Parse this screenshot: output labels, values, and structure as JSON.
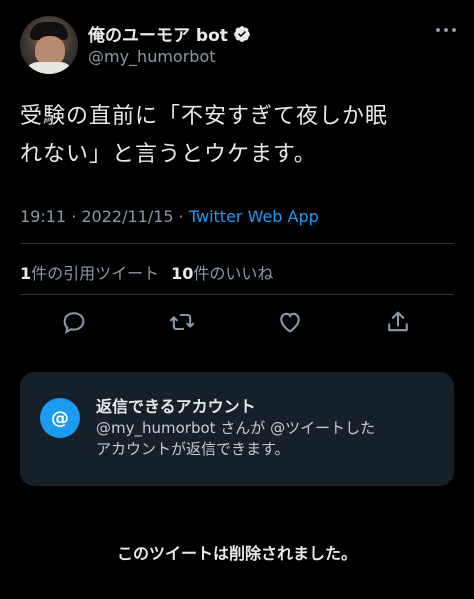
{
  "author": {
    "display_name": "俺のユーモア bot",
    "handle": "@my_humorbot",
    "verified": true,
    "avatar": "avatar-photo"
  },
  "tweet": {
    "text_line1": "受験の直前に「不安すぎて夜しか眠",
    "text_line2": "れない」と言うとウケます。",
    "time": "19:11",
    "sep1": " · ",
    "date": "2022/11/15",
    "sep2": " · ",
    "source": "Twitter Web App"
  },
  "stats": {
    "quotes_count": "1",
    "quotes_label": "件の引用ツイート",
    "likes_count": "10",
    "likes_label": "件のいいね"
  },
  "actions": [
    {
      "icon": "reply-icon"
    },
    {
      "icon": "retweet-icon"
    },
    {
      "icon": "like-icon"
    },
    {
      "icon": "share-icon"
    }
  ],
  "reply_restriction": {
    "icon_text": "@",
    "title": "返信できるアカウント",
    "desc_line1": "@my_humorbot さんが @ツイートした",
    "desc_line2": "アカウントが返信できます。"
  },
  "notice": "このツイートは削除されました。",
  "colors": {
    "background": "#000000",
    "text": "#e7e9ea",
    "muted": "#8b98a5",
    "accent": "#1d9bf0",
    "card": "#15202b"
  }
}
